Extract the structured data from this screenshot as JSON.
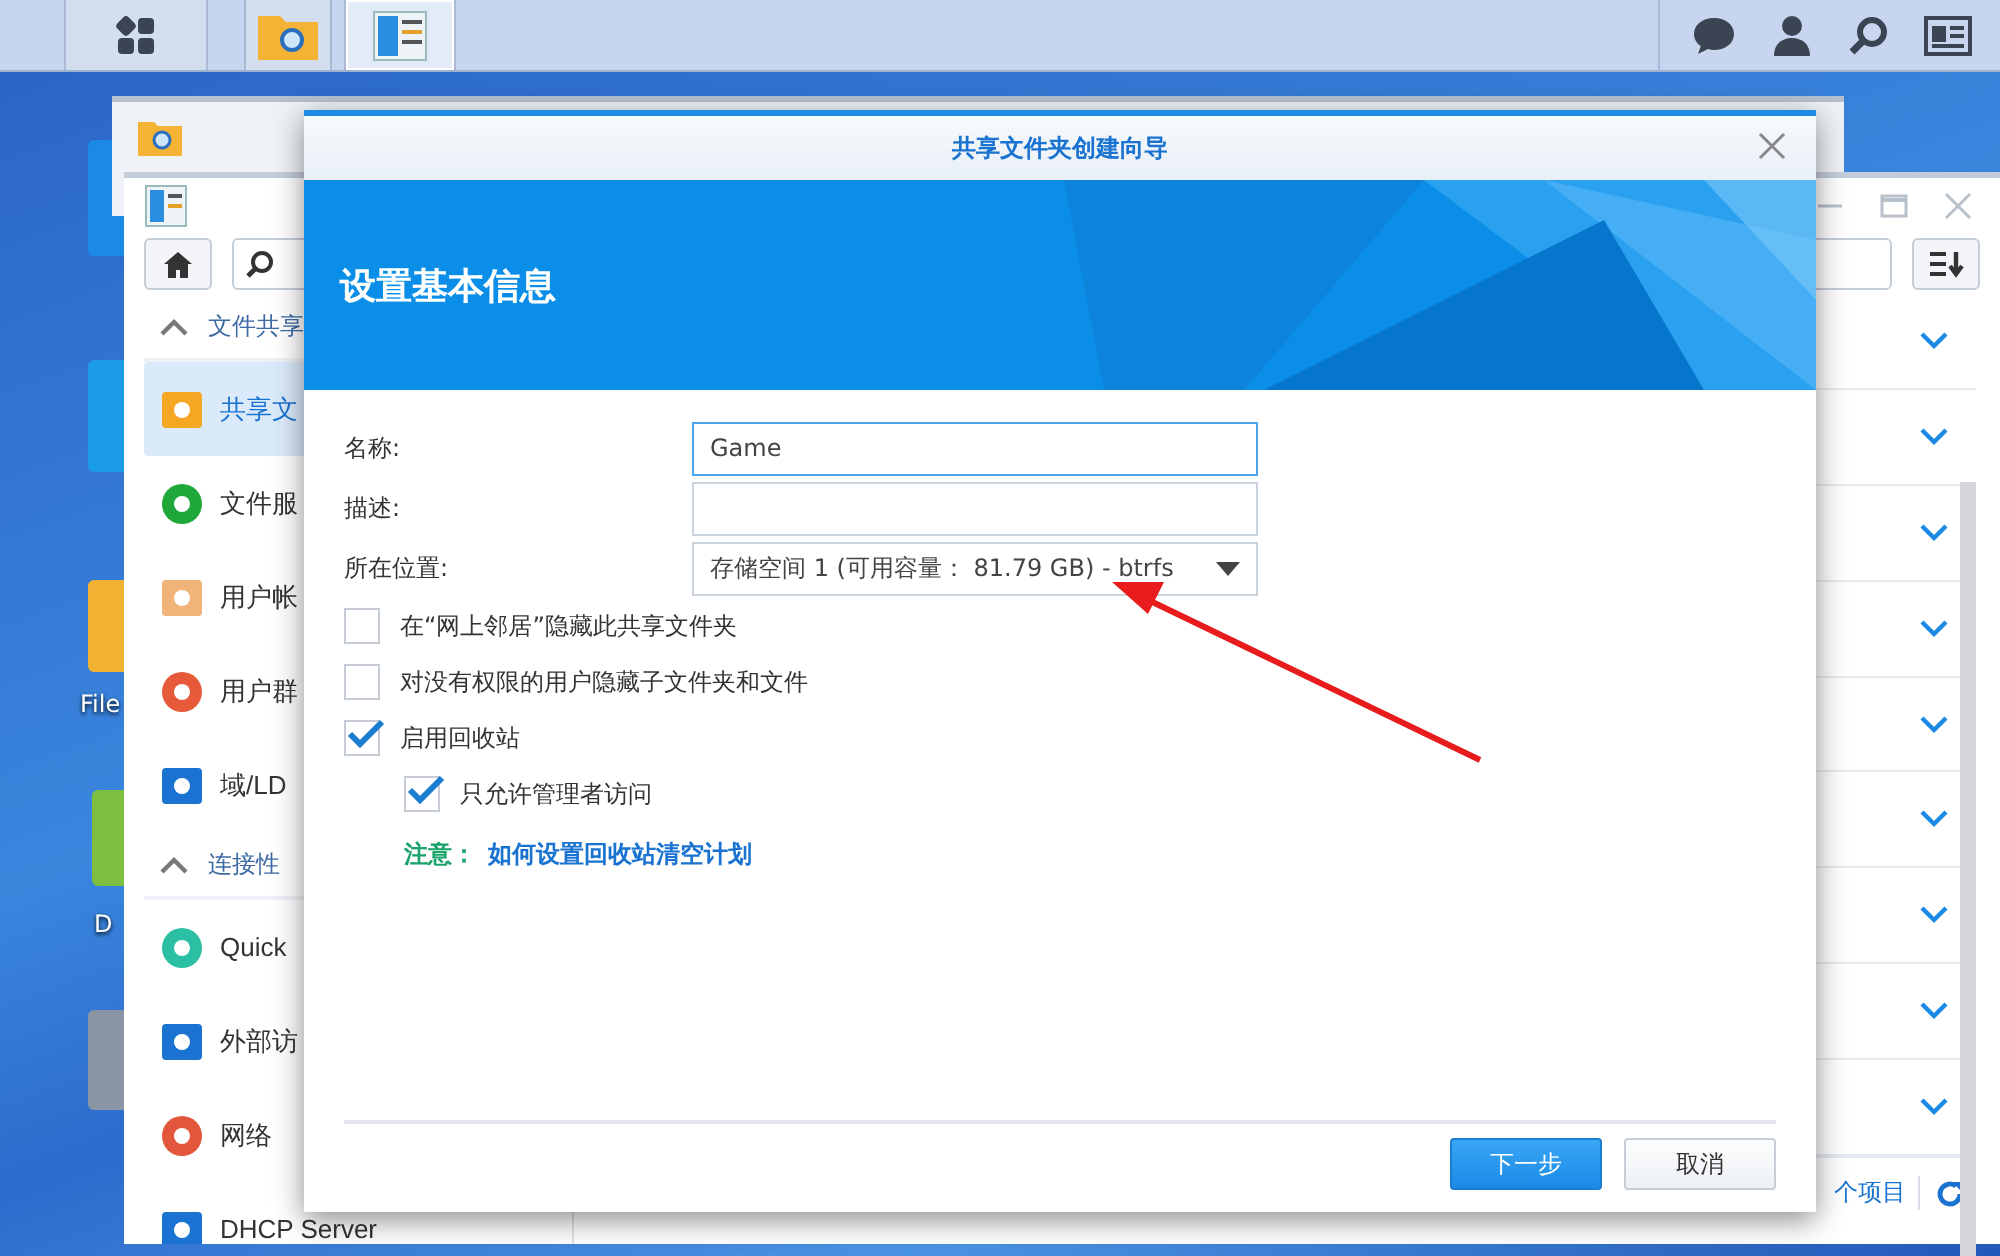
{
  "taskbar": {
    "apps": [
      {
        "kind": "launcher",
        "selected": false
      },
      {
        "kind": "file-station",
        "selected": false
      },
      {
        "kind": "control-panel",
        "selected": true
      }
    ]
  },
  "desktop_icons": [
    {
      "label": "File"
    },
    {
      "label": "D"
    }
  ],
  "control_panel": {
    "sidebar": [
      {
        "kind": "section",
        "label": "文件共享",
        "expanded": true
      },
      {
        "kind": "item",
        "label": "共享文",
        "selected": true
      },
      {
        "kind": "item",
        "label": "文件服",
        "selected": false
      },
      {
        "kind": "item",
        "label": "用户帐",
        "selected": false
      },
      {
        "kind": "item",
        "label": "用户群",
        "selected": false
      },
      {
        "kind": "item",
        "label": "域/LD",
        "selected": false
      },
      {
        "kind": "section",
        "label": "连接性",
        "expanded": true
      },
      {
        "kind": "item",
        "label": "Quick",
        "selected": false
      },
      {
        "kind": "item",
        "label": "外部访",
        "selected": false
      },
      {
        "kind": "item",
        "label": "网络",
        "selected": false
      },
      {
        "kind": "item",
        "label": "DHCP Server",
        "selected": false
      }
    ],
    "rows": [
      {
        "expanded": false
      },
      {
        "expanded": false
      },
      {
        "expanded": false
      },
      {
        "expanded": false
      },
      {
        "expanded": false
      },
      {
        "expanded": false
      },
      {
        "expanded": false
      },
      {
        "expanded": false
      },
      {
        "expanded": false
      }
    ],
    "footer": "个项目"
  },
  "dialog": {
    "title": "共享文件夹创建向导",
    "heading": "设置基本信息",
    "fields": [
      {
        "label": "名称:",
        "kind": "text",
        "value": "Game",
        "focused": true
      },
      {
        "label": "描述:",
        "kind": "text",
        "focused": false
      },
      {
        "label": "所在位置:",
        "kind": "select",
        "value": "存储空间 1 (可用容量： 81.79 GB) - btrfs",
        "focused": false
      }
    ],
    "options": [
      {
        "label": "在“网上邻居”隐藏此共享文件夹",
        "checked": false
      },
      {
        "label": "对没有权限的用户隐藏子文件夹和文件",
        "checked": false
      },
      {
        "label": "启用回收站",
        "checked": true,
        "children": [
          {
            "label": "只允许管理者访问",
            "checked": true
          }
        ]
      }
    ],
    "note": {
      "label": "注意：",
      "link": "如何设置回收站清空计划"
    },
    "buttons": [
      {
        "label": "下一步",
        "kind": "primary"
      },
      {
        "label": "取消",
        "kind": "secondary"
      }
    ]
  }
}
